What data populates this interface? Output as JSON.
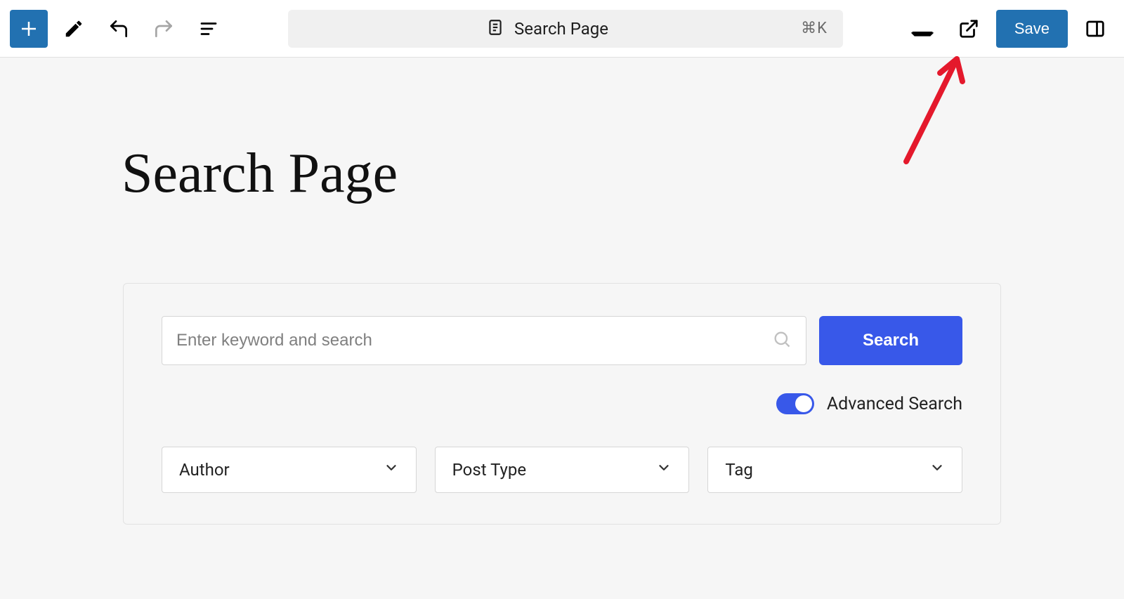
{
  "toolbar": {
    "doc_title": "Search Page",
    "shortcut": "⌘K",
    "save_label": "Save"
  },
  "page": {
    "title": "Search Page"
  },
  "search_block": {
    "placeholder": "Enter keyword and search",
    "button_label": "Search",
    "advanced_label": "Advanced Search",
    "advanced_on": true,
    "selects": [
      {
        "label": "Author"
      },
      {
        "label": "Post Type"
      },
      {
        "label": "Tag"
      }
    ]
  }
}
